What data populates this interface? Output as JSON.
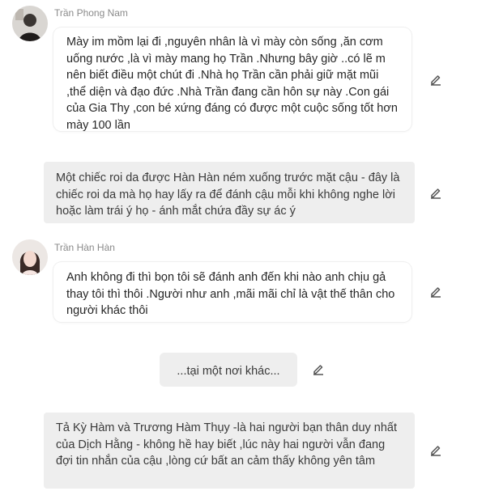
{
  "messages": [
    {
      "sender": "Trần Phong Nam",
      "text": "Mày im mồm lại đi ,nguyên nhân là vì mày còn sống ,ăn cơm uống nước ,là vì mày mang họ Trần .Nhưng bây giờ ..có lẽ m nên biết điều một chút đi .Nhà họ Trần cần phải giữ mặt mũi ,thể diện và đạo đức .Nhà Trần đang cần hôn sự này .Con gái của Gia Thy ,con bé xứng đáng có được một cuộc sống tốt hơn mày 100 lần"
    },
    {
      "narration": "Một chiếc roi da được Hàn Hàn ném xuống trước mặt cậu - đây là chiếc roi da mà họ hay lấy ra để đánh cậu mỗi khi không nghe lời hoặc làm trái ý họ - ánh mắt chứa đầy sự ác ý"
    },
    {
      "sender": "Trần Hàn Hàn",
      "text": "Anh không đi thì bọn tôi sẽ đánh anh đến khi nào anh chịu gả thay tôi thì thôi .Người như anh ,mãi mãi chỉ là vật thế thân cho người khác thôi"
    },
    {
      "scene": "...tại một nơi khác..."
    },
    {
      "narration": "Tả Kỳ Hàm và Trương Hàm Thụy -là hai người bạn thân duy nhất của Dịch Hằng - không hề hay biết ,lúc này hai người vẫn đang đợi tin nhắn của cậu ,lòng cứ bất an cảm thấy không yên tâm"
    }
  ]
}
